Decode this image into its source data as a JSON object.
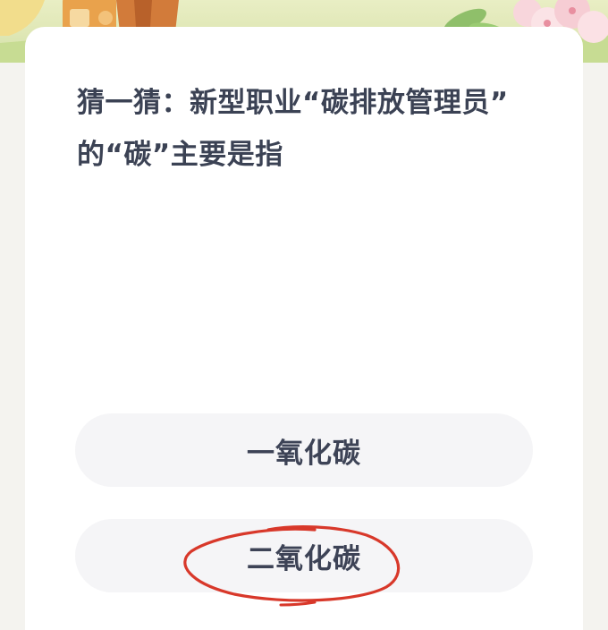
{
  "question": {
    "line1": "猜一猜：新型职业“碳排放管理员”",
    "line2": "的“碳”主要是指"
  },
  "options": [
    {
      "label": "一氧化碳"
    },
    {
      "label": "二氧化碳"
    }
  ],
  "annotation": {
    "type": "hand-drawn-circle",
    "target_option": "二氧化碳",
    "color": "#d8382a"
  },
  "colors": {
    "card": "#ffffff",
    "option_bg": "#f5f5f7",
    "text": "#3b4254",
    "banner": "#dfe7b5"
  }
}
